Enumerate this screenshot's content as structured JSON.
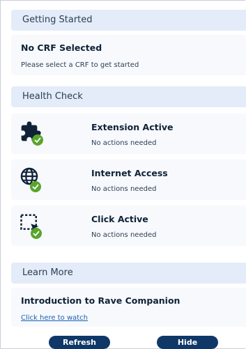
{
  "getting_started": {
    "header": "Getting Started",
    "title": "No CRF Selected",
    "subtitle": "Please select a CRF to get started"
  },
  "health_check": {
    "header": "Health Check",
    "items": [
      {
        "title": "Extension Active",
        "status": "No actions needed",
        "icon": "puzzle-icon"
      },
      {
        "title": "Internet Access",
        "status": "No actions needed",
        "icon": "globe-icon"
      },
      {
        "title": "Click Active",
        "status": "No actions needed",
        "icon": "click-select-icon"
      }
    ]
  },
  "learn_more": {
    "header": "Learn More",
    "title": "Introduction to Rave Companion",
    "link": "Click here to watch"
  },
  "footer": {
    "refresh_label": "Refresh",
    "hide_label": "Hide"
  },
  "colors": {
    "header_bg": "#e3ecf8",
    "button_bg": "#0f3868",
    "check_green": "#58a52b"
  }
}
